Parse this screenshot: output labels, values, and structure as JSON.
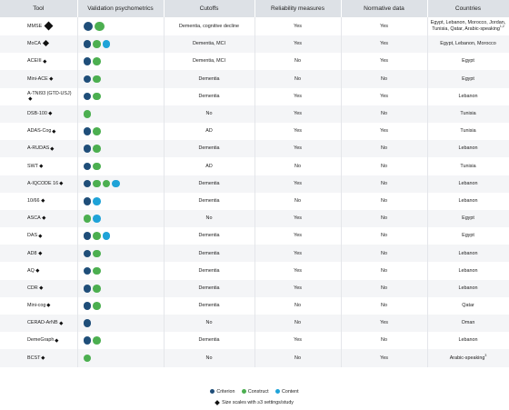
{
  "colors": {
    "criterion": "#1f4e79",
    "construct": "#4caf50",
    "content": "#1fa3d8",
    "header_bg": "#dde1e6",
    "stripe": "#f4f5f7"
  },
  "headers": [
    "Tool",
    "Validation psychometrics",
    "Cutoffs",
    "Reliability measures",
    "Normative data",
    "Countries"
  ],
  "rows": [
    {
      "tool": "MMSE",
      "size": "lg",
      "dots": [
        "criterion",
        "construct"
      ],
      "cutoffs": "Dementia, cognitive decline",
      "reliability": "Yes",
      "normative": "Yes",
      "countries": "Egypt, Lebanon, Morocco, Jordan, Tunisia, Qatar, Arabic-speaking",
      "countries_sup": "1,2"
    },
    {
      "tool": "MoCA",
      "size": "md",
      "dots": [
        "criterion",
        "construct",
        "content"
      ],
      "cutoffs": "Dementia, MCI",
      "reliability": "Yes",
      "normative": "Yes",
      "countries": "Egypt, Lebanon, Morocco",
      "countries_sup": ""
    },
    {
      "tool": "ACEIII",
      "size": "sm",
      "dots": [
        "criterion",
        "construct"
      ],
      "cutoffs": "Dementia, MCI",
      "reliability": "No",
      "normative": "Yes",
      "countries": "Egypt",
      "countries_sup": ""
    },
    {
      "tool": "Mini-ACE",
      "size": "sm",
      "dots": [
        "criterion",
        "construct"
      ],
      "cutoffs": "Dementia",
      "reliability": "No",
      "normative": "No",
      "countries": "Egypt",
      "countries_sup": ""
    },
    {
      "tool": "A-TNI93 (GTD-USJ)",
      "size": "sm",
      "dots": [
        "criterion",
        "construct"
      ],
      "cutoffs": "Dementia",
      "reliability": "Yes",
      "normative": "Yes",
      "countries": "Lebanon",
      "countries_sup": ""
    },
    {
      "tool": "DSB-100",
      "size": "sm",
      "dots": [
        "construct"
      ],
      "cutoffs": "No",
      "reliability": "Yes",
      "normative": "No",
      "countries": "Tunisia",
      "countries_sup": ""
    },
    {
      "tool": "ADAS-Cog",
      "size": "sm",
      "dots": [
        "criterion",
        "construct"
      ],
      "cutoffs": "AD",
      "reliability": "Yes",
      "normative": "Yes",
      "countries": "Tunisia",
      "countries_sup": ""
    },
    {
      "tool": "A-RUDAS",
      "size": "sm",
      "dots": [
        "criterion",
        "construct"
      ],
      "cutoffs": "Dementia",
      "reliability": "Yes",
      "normative": "No",
      "countries": "Lebanon",
      "countries_sup": ""
    },
    {
      "tool": "SWT",
      "size": "sm",
      "dots": [
        "criterion",
        "construct"
      ],
      "cutoffs": "AD",
      "reliability": "No",
      "normative": "No",
      "countries": "Tunisia",
      "countries_sup": ""
    },
    {
      "tool": "A-IQCODE 16",
      "size": "sm",
      "dots": [
        "criterion",
        "construct",
        "construct",
        "content"
      ],
      "cutoffs": "Dementia",
      "reliability": "Yes",
      "normative": "No",
      "countries": "Lebanon",
      "countries_sup": ""
    },
    {
      "tool": "10/66",
      "size": "sm",
      "dots": [
        "criterion",
        "content"
      ],
      "cutoffs": "Dementia",
      "reliability": "No",
      "normative": "No",
      "countries": "Lebanon",
      "countries_sup": ""
    },
    {
      "tool": "ASCA",
      "size": "sm",
      "dots": [
        "construct",
        "content"
      ],
      "cutoffs": "No",
      "reliability": "Yes",
      "normative": "No",
      "countries": "Egypt",
      "countries_sup": ""
    },
    {
      "tool": "DAS",
      "size": "sm",
      "dots": [
        "criterion",
        "construct",
        "content"
      ],
      "cutoffs": "Dementia",
      "reliability": "Yes",
      "normative": "No",
      "countries": "Egypt",
      "countries_sup": ""
    },
    {
      "tool": "AD8",
      "size": "sm",
      "dots": [
        "criterion",
        "construct"
      ],
      "cutoffs": "Dementia",
      "reliability": "Yes",
      "normative": "No",
      "countries": "Lebanon",
      "countries_sup": ""
    },
    {
      "tool": "AQ",
      "size": "sm",
      "dots": [
        "criterion",
        "construct"
      ],
      "cutoffs": "Dementia",
      "reliability": "Yes",
      "normative": "No",
      "countries": "Lebanon",
      "countries_sup": ""
    },
    {
      "tool": "CDR",
      "size": "sm",
      "dots": [
        "criterion",
        "construct"
      ],
      "cutoffs": "Dementia",
      "reliability": "Yes",
      "normative": "No",
      "countries": "Lebanon",
      "countries_sup": ""
    },
    {
      "tool": "Mini-cog",
      "size": "sm",
      "dots": [
        "criterion",
        "construct"
      ],
      "cutoffs": "Dementia",
      "reliability": "No",
      "normative": "No",
      "countries": "Qatar",
      "countries_sup": ""
    },
    {
      "tool": "CERAD-ArNB",
      "size": "sm",
      "dots": [
        "criterion"
      ],
      "cutoffs": "No",
      "reliability": "No",
      "normative": "Yes",
      "countries": "Oman",
      "countries_sup": ""
    },
    {
      "tool": "DemeGraph",
      "size": "sm",
      "dots": [
        "criterion",
        "construct"
      ],
      "cutoffs": "Dementia",
      "reliability": "Yes",
      "normative": "No",
      "countries": "Lebanon",
      "countries_sup": ""
    },
    {
      "tool": "BCST",
      "size": "sm",
      "dots": [
        "construct"
      ],
      "cutoffs": "No",
      "reliability": "No",
      "normative": "Yes",
      "countries": "Arabic-speaking",
      "countries_sup": "3"
    }
  ],
  "legend": {
    "criterion": "Criterion",
    "construct": "Construct",
    "content": "Content",
    "size_note": "Size scales with ≥3 settings/study"
  }
}
